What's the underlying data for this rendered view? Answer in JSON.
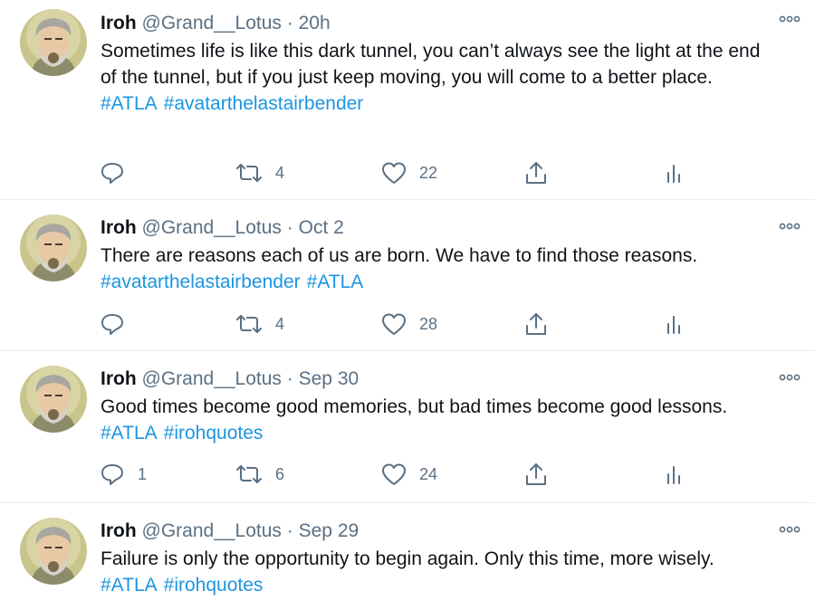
{
  "colors": {
    "link": "#1b95e0",
    "meta": "#5b7083",
    "text": "#0f1419",
    "divider": "#e6ecf0"
  },
  "icons": [
    "more-icon",
    "reply-icon",
    "retweet-icon",
    "like-icon",
    "share-icon",
    "analytics-icon",
    "avatar-image"
  ],
  "tweets": [
    {
      "name": "Iroh",
      "handle": "@Grand__Lotus",
      "sep": "·",
      "time": "20h",
      "text": "Sometimes life is like this dark tunnel, you can’t always see the light at the end of the tunnel, but if you just keep moving, you will come to a better place.",
      "tags": [
        "#ATLA",
        "#avatarthelastairbender"
      ],
      "replies": "",
      "retweets": "4",
      "likes": "22"
    },
    {
      "name": "Iroh",
      "handle": "@Grand__Lotus",
      "sep": "·",
      "time": "Oct 2",
      "text": "There are reasons each of us are born. We have to find those reasons.",
      "tags": [
        "#avatarthelastairbender",
        "#ATLA"
      ],
      "replies": "",
      "retweets": "4",
      "likes": "28"
    },
    {
      "name": "Iroh",
      "handle": "@Grand__Lotus",
      "sep": "·",
      "time": "Sep 30",
      "text": "Good times become good memories, but bad times become good lessons.",
      "tags": [
        "#ATLA",
        "#irohquotes"
      ],
      "replies": "1",
      "retweets": "6",
      "likes": "24"
    },
    {
      "name": "Iroh",
      "handle": "@Grand__Lotus",
      "sep": "·",
      "time": "Sep 29",
      "text": "Failure is only the opportunity to begin again. Only this time, more wisely.",
      "tags": [
        "#ATLA",
        "#irohquotes"
      ],
      "replies": "",
      "retweets": "",
      "likes": ""
    }
  ]
}
